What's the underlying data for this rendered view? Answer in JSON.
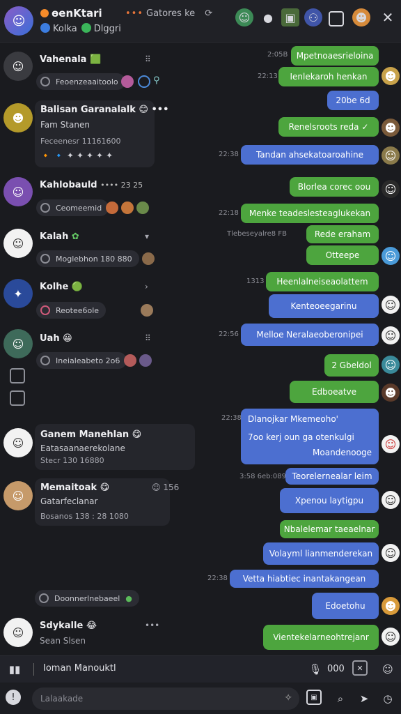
{
  "header": {
    "title": "ɵenKtari",
    "subtitle_a": "Kolka",
    "subtitle_b": "Dlggri",
    "channel": "Gatores ke",
    "channel_dots": "•••"
  },
  "conversations": [
    {
      "name": "Vahenala",
      "preview": "Feoenzeaaitoolo",
      "emoji": "🟩"
    },
    {
      "name": "Balisan Garanalalk",
      "line2": "Fam Stanen",
      "line3": "Feceenesr 11161600",
      "emoji": "😊"
    },
    {
      "name": "Kahlobauld",
      "preview": "Ceomeemid",
      "tags": "•••• 23  25"
    },
    {
      "name": "Kalah",
      "preview": "Moglebhon 180 880",
      "emoji": "🎭"
    },
    {
      "name": "Kolhe",
      "preview": "Reotee6ole",
      "emoji": "🟢"
    },
    {
      "name": "Uah",
      "preview": "Ineialeabeto 2o6",
      "emoji": "😀"
    },
    {
      "name": "Ganem Manehlan",
      "line2": "Eatasaanaerekolane",
      "line3": "Stecr 130 16880",
      "emoji": "😋"
    },
    {
      "name": "Memaitoak",
      "line2": "Gatarfeclanar",
      "line3": "Bosanos 138 : 28 1080",
      "emoji": "😋",
      "side": "☺  156"
    },
    {
      "preview": "Doonnerlnebaeel"
    },
    {
      "name": "Sdykalle",
      "preview": "Sean Slsen",
      "emoji": "😂"
    }
  ],
  "messages": [
    {
      "time": "2:05B",
      "text": "Mpetnoaesrieloina",
      "color": "green"
    },
    {
      "time": "22:13",
      "text": "Ienlekaroh henkan",
      "color": "green"
    },
    {
      "text": "20be 6d",
      "color": "blue"
    },
    {
      "text": "Renelsroots reda ✓",
      "color": "green"
    },
    {
      "time": "22:38",
      "text": "Tandan ahsekatoaroahine",
      "color": "blue"
    },
    {
      "text": "Blorlea corec oou",
      "color": "green"
    },
    {
      "time": "22:18",
      "text": "Menke teadeslesteaglukekan",
      "color": "green"
    },
    {
      "time": "Tlebeseyalre8 FB",
      "text": "Rede eraham",
      "color": "green"
    },
    {
      "text": "Otteepe",
      "color": "green"
    },
    {
      "time": "1313",
      "text": "Heenlalneiseaolattem",
      "color": "green"
    },
    {
      "text": "Kenteoeegarinu",
      "color": "blue"
    },
    {
      "time": "22:56",
      "text": "Melloe Neralaeoberonipei",
      "color": "blue"
    },
    {
      "text": "2 Gbeldol",
      "color": "green"
    },
    {
      "text": "Edboeatve",
      "color": "green"
    },
    {
      "time": "22:38",
      "lines": [
        "Dlanojkar Mkemeoho'",
        "7oo kerj oun ga otenkulgi",
        "Moandenooge"
      ],
      "color": "blue"
    },
    {
      "time": "3:58 6eb:089",
      "text": "Teorelernealar leim",
      "color": "blue"
    },
    {
      "text": "Xpenou laytigpu",
      "color": "blue"
    },
    {
      "text": "Nbalelemar taeaelnar",
      "color": "green"
    },
    {
      "text": "Volayml lianmenderekan",
      "color": "blue"
    },
    {
      "time": "22:38",
      "text": "Vetta hiabtiec inantakangean",
      "color": "blue"
    },
    {
      "text": "Edoetohu",
      "color": "blue"
    },
    {
      "text": "Vientekelarneohtrejanr",
      "color": "green"
    }
  ],
  "bottom_bar": {
    "label": "Ioman Manouktl",
    "count": "000"
  },
  "composer": {
    "placeholder": "Lalaakade"
  },
  "colors": {
    "bubble_green": "#4da53e",
    "bubble_blue": "#4c6fd0",
    "background": "#1a1b1f"
  }
}
